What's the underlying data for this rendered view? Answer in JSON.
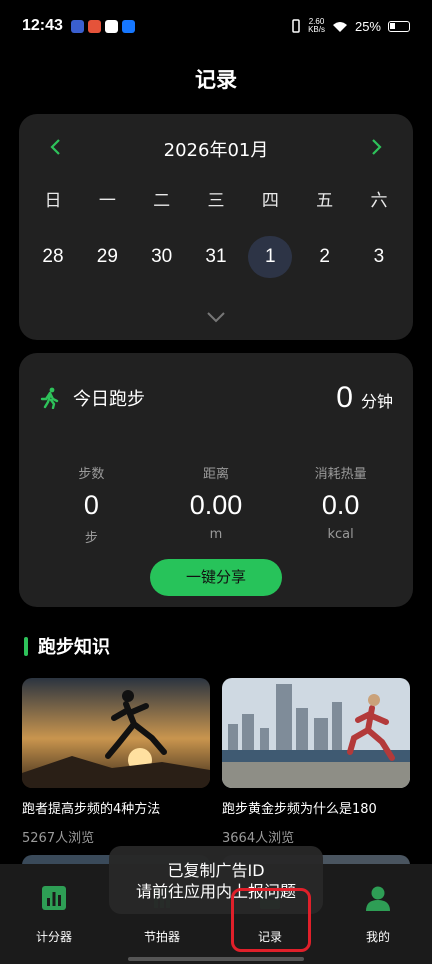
{
  "status_bar": {
    "time": "12:43",
    "net_speed_value": "2.60",
    "net_speed_unit": "KB/s",
    "battery": "25%"
  },
  "page_title": "记录",
  "calendar": {
    "month": "2026年01月",
    "weekdays": [
      "日",
      "一",
      "二",
      "三",
      "四",
      "五",
      "六"
    ],
    "days": [
      "28",
      "29",
      "30",
      "31",
      "1",
      "2",
      "3"
    ],
    "selected_day": "1"
  },
  "run_card": {
    "title": "今日跑步",
    "minutes": "0",
    "minutes_unit": "分钟",
    "stats": [
      {
        "label": "步数",
        "value": "0",
        "unit": "步"
      },
      {
        "label": "距离",
        "value": "0.00",
        "unit": "m"
      },
      {
        "label": "消耗热量",
        "value": "0.0",
        "unit": "kcal"
      }
    ],
    "share_label": "一键分享"
  },
  "knowledge": {
    "section_title": "跑步知识",
    "articles": [
      {
        "title": "跑者提高步频的4种方法",
        "views": "5267人浏览"
      },
      {
        "title": "跑步黄金步频为什么是180",
        "views": "3664人浏览"
      }
    ]
  },
  "toast": {
    "line1": "已复制广告ID",
    "line2": "请前往应用内上报问题"
  },
  "tabs": [
    {
      "label": "计分器",
      "icon": "bar-chart-icon"
    },
    {
      "label": "节拍器",
      "icon": "metronome-icon"
    },
    {
      "label": "记录",
      "icon": "record-icon"
    },
    {
      "label": "我的",
      "icon": "profile-icon"
    }
  ],
  "colors": {
    "accent": "#2ec25a",
    "card": "#212121",
    "selected_day": "#2d3446",
    "highlight": "#e0202a"
  }
}
